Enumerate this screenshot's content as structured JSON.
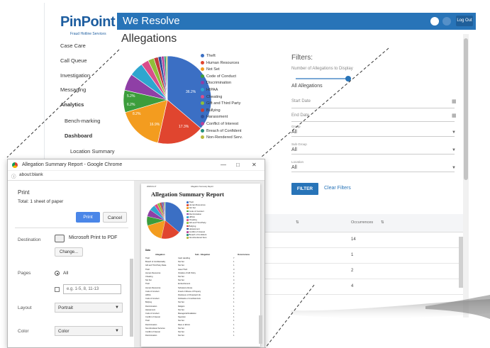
{
  "app": {
    "brand": "PinPoint",
    "brand_tagline": "Fraud Hotline Services",
    "title": "We Resolve",
    "logout_label": "Log Out",
    "page_title": "Allegations"
  },
  "sidebar": {
    "items": [
      {
        "label": "Case Care"
      },
      {
        "label": "Call Queue"
      },
      {
        "label": "Investigation"
      },
      {
        "label": "Messaging"
      },
      {
        "label": "Analytics"
      },
      {
        "label": "Bench-marking"
      },
      {
        "label": "Dashboard"
      },
      {
        "label": "Location Summary"
      }
    ]
  },
  "pie": {
    "legend": [
      "Theft",
      "Human Resources",
      "Not Set",
      "Code of Conduct",
      "Discrimination",
      "HIPAA",
      "Cheating",
      "Gift and Third Party",
      "Bullying",
      "Harassment",
      "Conflict of Interest",
      "Breach of Confident",
      "Non-Rendered Serv."
    ],
    "colors": [
      "#3b6fc4",
      "#e0452f",
      "#f39c1f",
      "#3c9d3c",
      "#8f3fa6",
      "#2fa6cf",
      "#d94d8a",
      "#8fbf3a",
      "#c23b3b",
      "#2d4e9a",
      "#b5419a",
      "#238f7a",
      "#b8b83c"
    ],
    "slice_labels": [
      "36.2%",
      "17.3%",
      "16.9%",
      "8.2%",
      "6.2%",
      "5.2%"
    ]
  },
  "chart_data": {
    "type": "pie",
    "categories": [
      "Theft",
      "Human Resources",
      "Not Set",
      "Code of Conduct",
      "Discrimination",
      "HIPAA",
      "Cheating",
      "Gift and Third Party",
      "Bullying",
      "Harassment",
      "Conflict of Interest",
      "Breach of Confident",
      "Non-Rendered Serv."
    ],
    "values": [
      36.2,
      17.3,
      16.9,
      8.2,
      6.2,
      5.2,
      2.8,
      2.2,
      1.6,
      1.2,
      1.0,
      0.7,
      0.5
    ]
  },
  "filters": {
    "title": "Filters:",
    "slider_label": "Number of Allegations to Display",
    "slider_value": 1.0,
    "allegations_value": "All Allegations",
    "start_date_placeholder": "Start Date",
    "end_date_placeholder": "End Date",
    "group_label": "Group",
    "group_value": "All",
    "subgroup_label": "Sub Group",
    "subgroup_value": "All",
    "location_label": "Location",
    "location_value": "All",
    "filter_button": "FILTER",
    "clear_link": "Clear Filters"
  },
  "table": {
    "occurrences_header": "Occurrences",
    "rows": [
      "14",
      "1",
      "2",
      "4"
    ]
  },
  "print_dialog": {
    "window_title": "Allegation Summary Report - Google Chrome",
    "address": "about:blank",
    "print_title": "Print",
    "total": "Total: 1 sheet of paper",
    "print_button": "Print",
    "cancel_button": "Cancel",
    "destination_label": "Destination",
    "destination_value": "Microsoft Print to PDF",
    "change_button": "Change...",
    "pages_label": "Pages",
    "pages_all": "All",
    "pages_placeholder": "e.g. 1-5, 8, 11-13",
    "layout_label": "Layout",
    "layout_value": "Portrait",
    "color_label": "Color",
    "color_value": "Color"
  },
  "report": {
    "header_left": "2018-04-17",
    "header_mid": "Allegation Summary Report",
    "title": "Allegation Summary Report",
    "data_label": "Data",
    "col_allegation": "Allegation",
    "col_sub": "Sub - Allegation",
    "col_occ": "Occurrences",
    "rows": [
      [
        "Theft",
        "Cash Handling",
        "7"
      ],
      [
        "Breach of Confidentiality",
        "Not Set",
        "1"
      ],
      [
        "Gift and Third Party Relat.",
        "Not Set",
        "1"
      ],
      [
        "Theft",
        "Asset Theft",
        "3"
      ],
      [
        "Human Resources",
        "Violation of HR Policy",
        "3"
      ],
      [
        "Cheating",
        "Not Set",
        "1"
      ],
      [
        "Not Set",
        "Not Set",
        "4"
      ],
      [
        "Theft",
        "Embezzlement",
        "2"
      ],
      [
        "Human Resources",
        "Substance Abuse",
        "2"
      ],
      [
        "Code of Conduct",
        "Fraud or Misuse of Property",
        "2"
      ],
      [
        "HIPAA",
        "Disclosure of Protected Info.",
        "1"
      ],
      [
        "Code of Conduct",
        "Kickbacks or Unethical Acts",
        "1"
      ],
      [
        "Bullying",
        "Not Set",
        "1"
      ],
      [
        "Discrimination",
        "Religion",
        "1"
      ],
      [
        "Harassment",
        "Not Set",
        "1"
      ],
      [
        "Code of Conduct",
        "Managerial Retaliation",
        "1"
      ],
      [
        "Conflict of Interest",
        "Nepotism",
        "1"
      ],
      [
        "Theft",
        "Not Set",
        "1"
      ],
      [
        "Discrimination",
        "Race or Ethnic",
        "1"
      ],
      [
        "Non-Rendered Services",
        "Not Set",
        "1"
      ],
      [
        "Conflict of Interest",
        "Not Set",
        "1"
      ],
      [
        "Discrimination",
        "Not Set",
        "1"
      ]
    ]
  }
}
